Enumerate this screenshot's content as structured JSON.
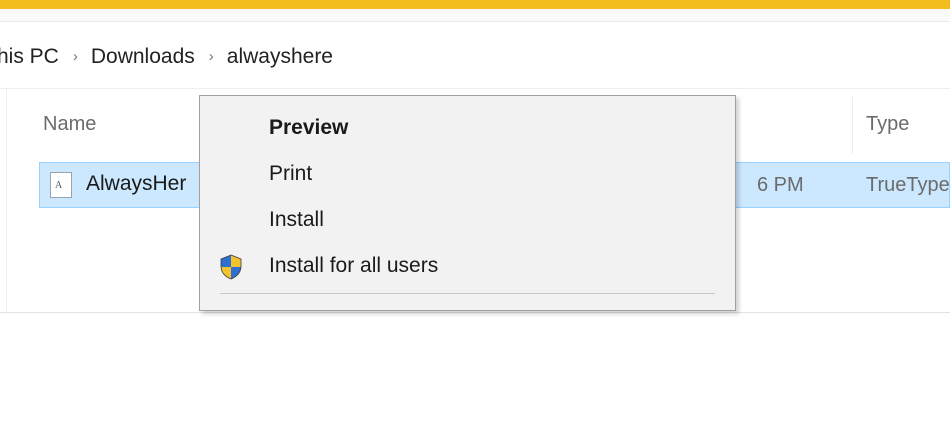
{
  "address_bar": {
    "crumbs": [
      "his PC",
      "Downloads",
      "alwayshere"
    ],
    "separator": "›"
  },
  "file_list": {
    "columns": {
      "name": "Name",
      "type": "Type"
    },
    "rows": [
      {
        "name": "AlwaysHer",
        "date_modified": "6 PM",
        "type": "TrueType",
        "selected": true
      }
    ]
  },
  "context_menu": {
    "items": [
      {
        "label": "Preview",
        "default": true
      },
      {
        "label": "Print"
      },
      {
        "label": "Install"
      },
      {
        "label": "Install for all users",
        "icon": "uac-shield-icon"
      }
    ]
  },
  "colors": {
    "accent_strip": "#f3bd1e",
    "selection_bg": "#cce8ff",
    "selection_border": "#99d1ff",
    "menu_bg": "#f2f2f2"
  }
}
